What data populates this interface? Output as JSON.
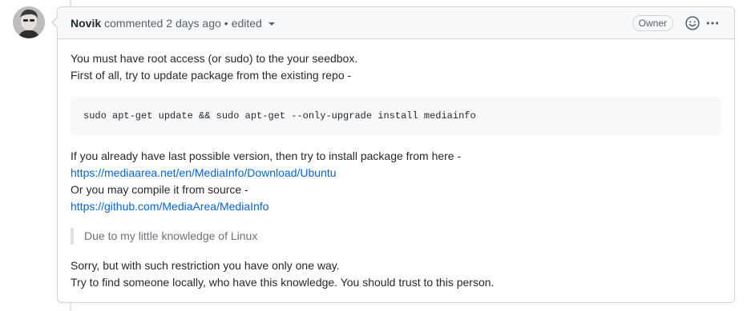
{
  "comment": {
    "author": "Novik",
    "action": "commented",
    "time": "2 days ago",
    "separator": "•",
    "edited": "edited",
    "role_badge": "Owner"
  },
  "icons": {
    "reaction": "smiley-icon",
    "more": "kebab-horizontal-icon",
    "edit_history": "triangle-down-icon"
  },
  "body": {
    "intro_line1": "You must have root access (or sudo) to the your seedbox.",
    "intro_line2": "First of all, try to update package from the existing repo -",
    "code": "sudo apt-get update && sudo apt-get --only-upgrade install mediainfo",
    "install_line": "If you already have last possible version, then try to install package from here -",
    "link1": "https://mediaarea.net/en/MediaInfo/Download/Ubuntu",
    "compile_line": "Or you may compile it from source -",
    "link2": "https://github.com/MediaArea/MediaInfo",
    "quote": "Due to my little knowledge of Linux",
    "outro_line1": "Sorry, but with such restriction you have only one way.",
    "outro_line2": "Try to find someone locally, who have this knowledge. You should trust to this person."
  },
  "colors": {
    "link": "#0366d6",
    "header_bg": "#f6f8fa",
    "border": "#d1d5da",
    "quote_text": "#6a737d"
  }
}
